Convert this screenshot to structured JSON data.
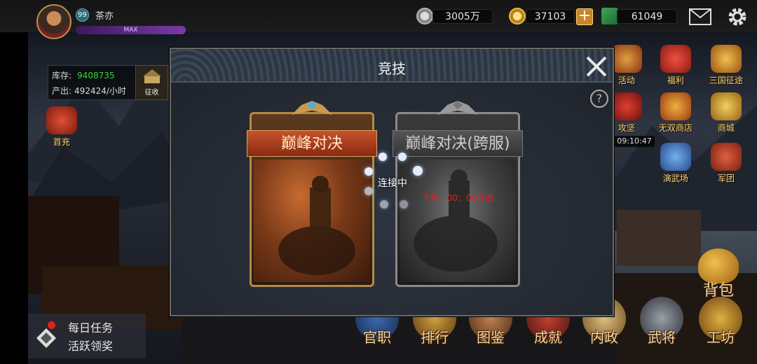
{
  "player": {
    "level": "99",
    "name": "茶亦",
    "vip_label": "MAX"
  },
  "resources": {
    "silver": "3005万",
    "gold": "37103",
    "cash": "61049"
  },
  "stock": {
    "stock_label": "库存:",
    "stock_value": "9408735",
    "output_label": "产出:",
    "output_value": "492424/小时",
    "collect_label": "征收"
  },
  "left_icons": [
    {
      "label": "首充"
    }
  ],
  "right_icons": [
    {
      "label": "活动"
    },
    {
      "label": "福利"
    },
    {
      "label": "三国征途"
    },
    {
      "label": "攻坚"
    },
    {
      "label": "无双商店"
    },
    {
      "label": "商城"
    },
    {
      "label": "演武场"
    },
    {
      "label": "军团"
    }
  ],
  "timer": "09:10:47",
  "tasks": {
    "daily": "每日任务",
    "reward": "活跃领奖"
  },
  "bottom_menu": [
    {
      "label": "官职"
    },
    {
      "label": "排行"
    },
    {
      "label": "图鉴"
    },
    {
      "label": "成就"
    },
    {
      "label": "内政"
    },
    {
      "label": "武将"
    },
    {
      "label": "工坊"
    }
  ],
  "bag_label": "背包",
  "modal": {
    "title": "竞技",
    "help": "?",
    "cards": [
      {
        "title": "巅峰对决",
        "note": ""
      },
      {
        "title": "巅峰对决(跨服)",
        "note": "下周一00：00开启"
      }
    ],
    "loading_text": "连接中"
  },
  "colors": {
    "stock_value": "#2ddb3a",
    "accent_gold": "#f3d69a",
    "note_red": "#e02020",
    "card_active_banner": "#c5532a"
  }
}
